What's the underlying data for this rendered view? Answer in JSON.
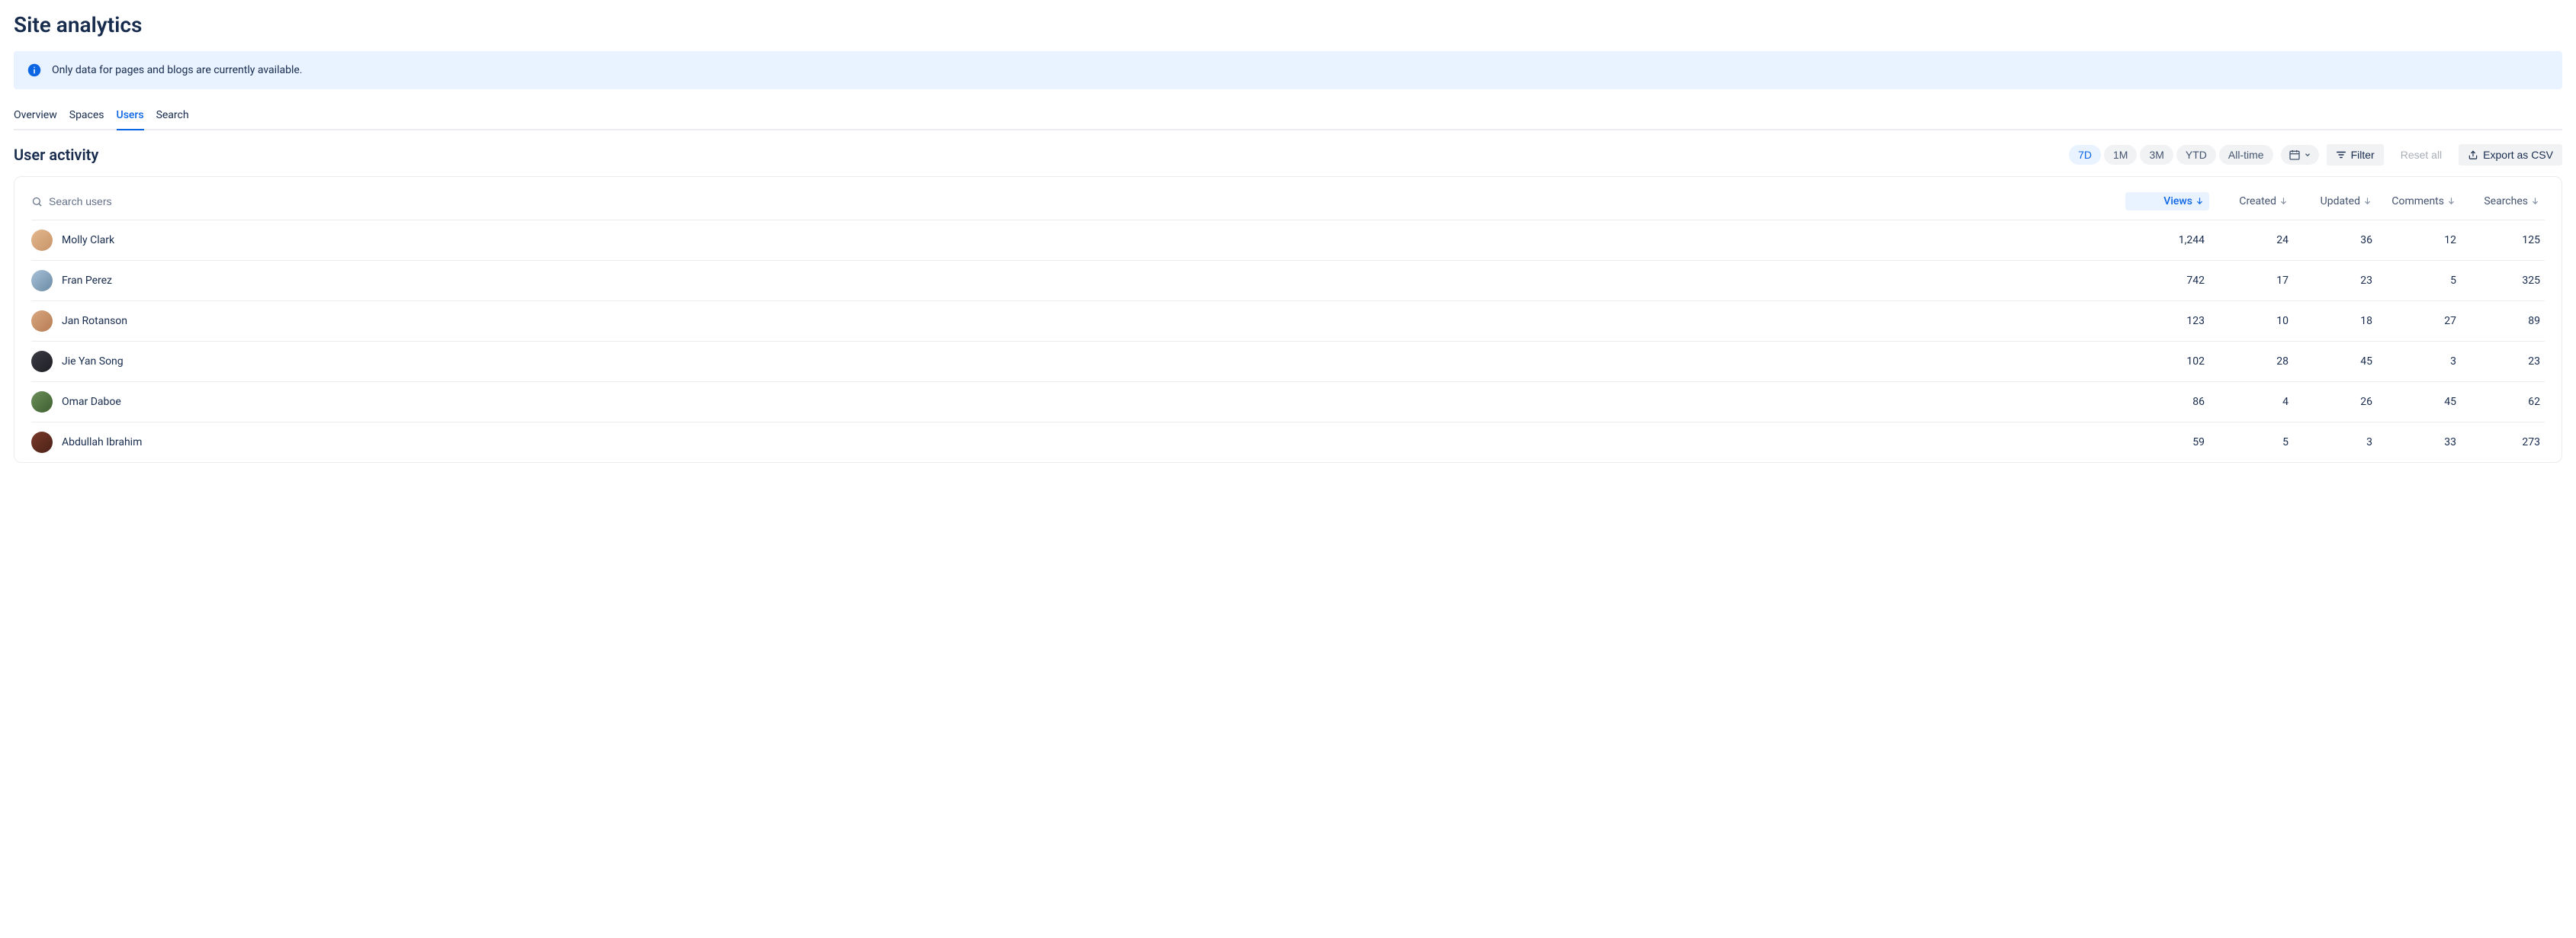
{
  "page_title": "Site analytics",
  "info_banner": "Only data for pages and blogs are currently available.",
  "tabs": [
    {
      "label": "Overview",
      "active": false
    },
    {
      "label": "Spaces",
      "active": false
    },
    {
      "label": "Users",
      "active": true
    },
    {
      "label": "Search",
      "active": false
    }
  ],
  "section_title": "User activity",
  "range_pills": [
    {
      "label": "7D",
      "active": true
    },
    {
      "label": "1M",
      "active": false
    },
    {
      "label": "3M",
      "active": false
    },
    {
      "label": "YTD",
      "active": false
    },
    {
      "label": "All-time",
      "active": false
    }
  ],
  "buttons": {
    "filter": "Filter",
    "reset": "Reset all",
    "export": "Export as CSV"
  },
  "search_placeholder": "Search users",
  "columns": [
    {
      "label": "Views",
      "active": true
    },
    {
      "label": "Created",
      "active": false
    },
    {
      "label": "Updated",
      "active": false
    },
    {
      "label": "Comments",
      "active": false
    },
    {
      "label": "Searches",
      "active": false
    }
  ],
  "rows": [
    {
      "name": "Molly Clark",
      "avatar_bg": "linear-gradient(135deg,#E2B88C,#C9946A)",
      "views": "1,244",
      "created": "24",
      "updated": "36",
      "comments": "12",
      "searches": "125"
    },
    {
      "name": "Fran Perez",
      "avatar_bg": "linear-gradient(135deg,#A8C0D8,#6B8BA4)",
      "views": "742",
      "created": "17",
      "updated": "23",
      "comments": "5",
      "searches": "325"
    },
    {
      "name": "Jan Rotanson",
      "avatar_bg": "linear-gradient(135deg,#D9A77F,#B57B54)",
      "views": "123",
      "created": "10",
      "updated": "18",
      "comments": "27",
      "searches": "89"
    },
    {
      "name": "Jie Yan Song",
      "avatar_bg": "linear-gradient(135deg,#3B3B44,#1E1E24)",
      "views": "102",
      "created": "28",
      "updated": "45",
      "comments": "3",
      "searches": "23"
    },
    {
      "name": "Omar Daboe",
      "avatar_bg": "linear-gradient(135deg,#6B8F5A,#3E5E30)",
      "views": "86",
      "created": "4",
      "updated": "26",
      "comments": "45",
      "searches": "62"
    },
    {
      "name": "Abdullah Ibrahim",
      "avatar_bg": "linear-gradient(135deg,#7A3A2A,#4B2118)",
      "views": "59",
      "created": "5",
      "updated": "3",
      "comments": "33",
      "searches": "273"
    }
  ]
}
